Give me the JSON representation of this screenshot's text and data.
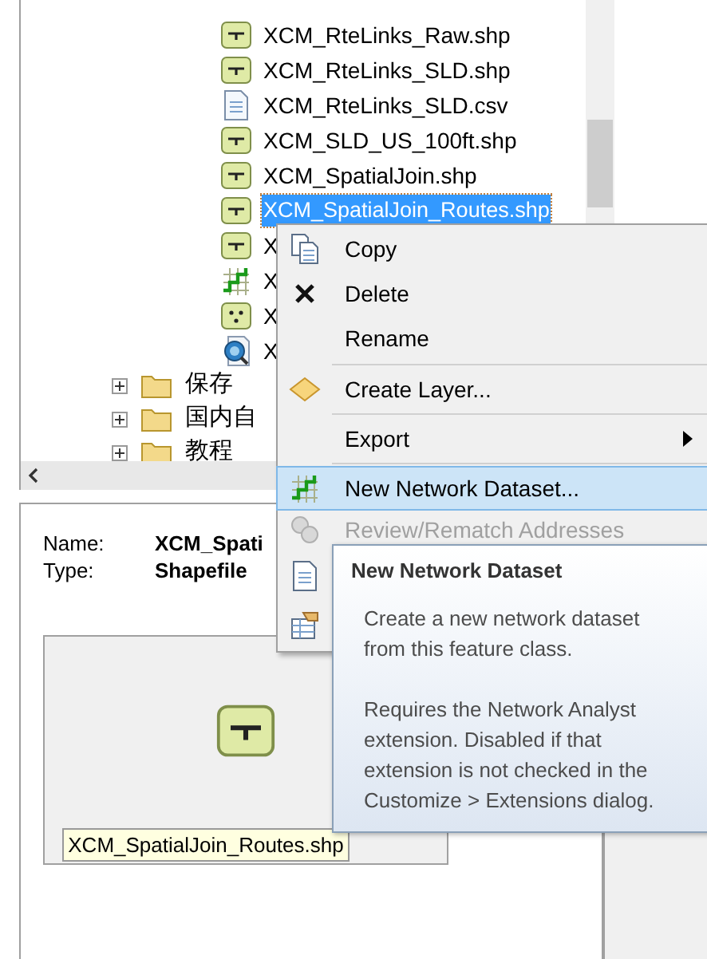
{
  "tree": {
    "items": [
      {
        "label": "XCM_RteLinks_Raw.shp",
        "kind": "line",
        "selected": false
      },
      {
        "label": "XCM_RteLinks_SLD.shp",
        "kind": "line",
        "selected": false
      },
      {
        "label": "XCM_RteLinks_SLD.csv",
        "kind": "table",
        "selected": false
      },
      {
        "label": "XCM_SLD_US_100ft.shp",
        "kind": "line",
        "selected": false
      },
      {
        "label": "XCM_SpatialJoin.shp",
        "kind": "line",
        "selected": false
      },
      {
        "label": "XCM_SpatialJoin_Routes.shp",
        "kind": "line",
        "selected": true
      },
      {
        "label": "X",
        "kind": "line",
        "selected": false
      },
      {
        "label": "X",
        "kind": "network",
        "selected": false
      },
      {
        "label": "X",
        "kind": "point",
        "selected": false
      },
      {
        "label": "X",
        "kind": "locator",
        "selected": false
      }
    ],
    "folders": [
      {
        "label": "保存",
        "expanded": false
      },
      {
        "label": "国内自",
        "expanded": false
      },
      {
        "label": "教程",
        "expanded": false
      }
    ]
  },
  "preview": {
    "fields": [
      {
        "label": "Name:",
        "value": "XCM_Spati"
      },
      {
        "label": "Type:",
        "value": "Shapefile"
      }
    ],
    "thumbnail_caption": "XCM_SpatialJoin_Routes.shp"
  },
  "context_menu": {
    "items": [
      {
        "kind": "item",
        "label": "Copy",
        "disabled": false,
        "highlighted": false,
        "submenu": false
      },
      {
        "kind": "item",
        "label": "Delete",
        "disabled": false,
        "highlighted": false,
        "submenu": false
      },
      {
        "kind": "item",
        "label": "Rename",
        "disabled": false,
        "highlighted": false,
        "submenu": false
      },
      {
        "kind": "separator"
      },
      {
        "kind": "item",
        "label": "Create Layer...",
        "disabled": false,
        "highlighted": false,
        "submenu": false
      },
      {
        "kind": "separator"
      },
      {
        "kind": "item",
        "label": "Export",
        "disabled": false,
        "highlighted": false,
        "submenu": true
      },
      {
        "kind": "separator"
      },
      {
        "kind": "item",
        "label": "New Network Dataset...",
        "disabled": false,
        "highlighted": true,
        "submenu": false
      },
      {
        "kind": "item",
        "label": "Review/Rematch Addresses",
        "disabled": true,
        "highlighted": false,
        "submenu": false
      },
      {
        "kind": "icon_only"
      },
      {
        "kind": "icon_only"
      }
    ]
  },
  "tooltip": {
    "title": "New Network Dataset",
    "paragraphs": [
      "Create a new network dataset from this feature class.",
      "Requires the Network Analyst extension. Disabled if that extension is not checked in the Customize > Extensions dialog."
    ]
  }
}
